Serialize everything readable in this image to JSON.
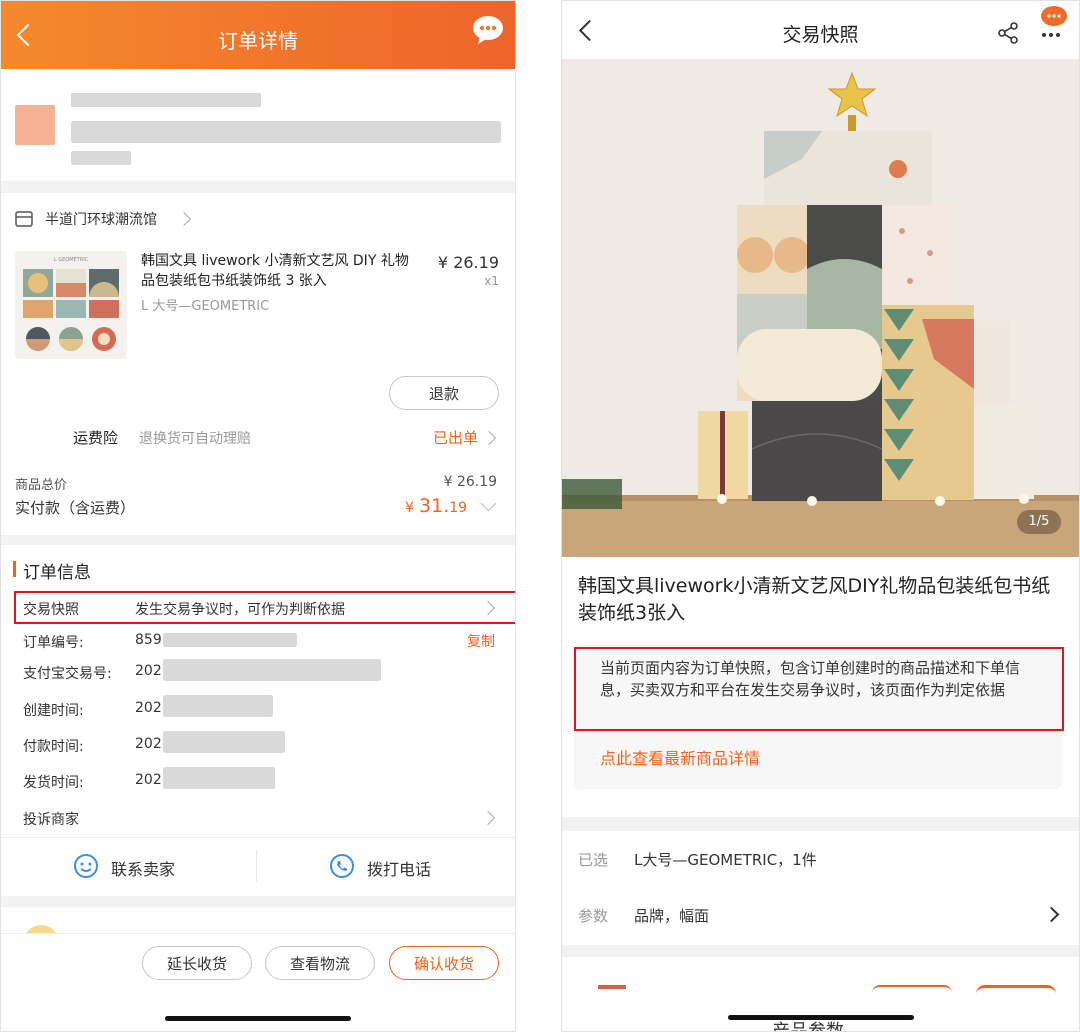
{
  "left": {
    "header": {
      "title": "订单详情",
      "bg_from": "#f5892c",
      "bg_to": "#ef6b2c"
    },
    "shop": {
      "name": "半道门环球潮流馆"
    },
    "product": {
      "title": "韩国文具 livework 小清新文艺风 DIY 礼物品包装纸包书纸装饰纸 3 张入",
      "thumb_text": "L GEOMETRIC",
      "spec": "L 大号—GEOMETRIC",
      "price": "¥ 26.19",
      "qty": "x1",
      "refund_label": "退款"
    },
    "insurance": {
      "label": "运费险",
      "desc": "退换货可自动理赔",
      "status": "已出单"
    },
    "totals": {
      "goods_label": "商品总价",
      "goods_value": "¥ 26.19",
      "paid_label": "实付款（含运费）",
      "paid_currency": "¥",
      "paid_int": "31.",
      "paid_dec": "19"
    },
    "order_info": {
      "section_title": "订单信息",
      "snapshot_label": "交易快照",
      "snapshot_desc": "发生交易争议时，可作为判断依据",
      "order_no_label": "订单编号:",
      "order_no_prefix": "859",
      "copy_label": "复制",
      "alipay_label": "支付宝交易号:",
      "alipay_prefix": "202",
      "created_label": "创建时间:",
      "created_prefix": "202",
      "paid_label": "付款时间:",
      "paid_prefix": "202",
      "shipped_label": "发货时间:",
      "shipped_prefix": "202",
      "complaint_label": "投诉商家"
    },
    "contact": {
      "seller": "联系卖家",
      "phone": "拨打电话"
    },
    "bottom_buttons": {
      "extend": "延长收货",
      "logistics": "查看物流",
      "confirm": "确认收货"
    },
    "accent": "#f2621e"
  },
  "right": {
    "header": {
      "title": "交易快照"
    },
    "gallery": {
      "indicator": "1/5"
    },
    "product_title": "韩国文具livework小清新文艺风DIY礼物品包装纸包书纸装饰纸3张入",
    "notice": {
      "text": "当前页面内容为订单快照，包含订单创建时的商品描述和下单信息，买卖双方和平台在发生交易争议时，该页面作为判定依据",
      "link": "点此查看最新商品详情"
    },
    "selected": {
      "label": "已选",
      "value": "L大号—GEOMETRIC，1件"
    },
    "params": {
      "label": "参数",
      "value": "品牌，幅面"
    },
    "bottom_cut_text": "产品参数"
  },
  "highlight_color": "#e0161b"
}
